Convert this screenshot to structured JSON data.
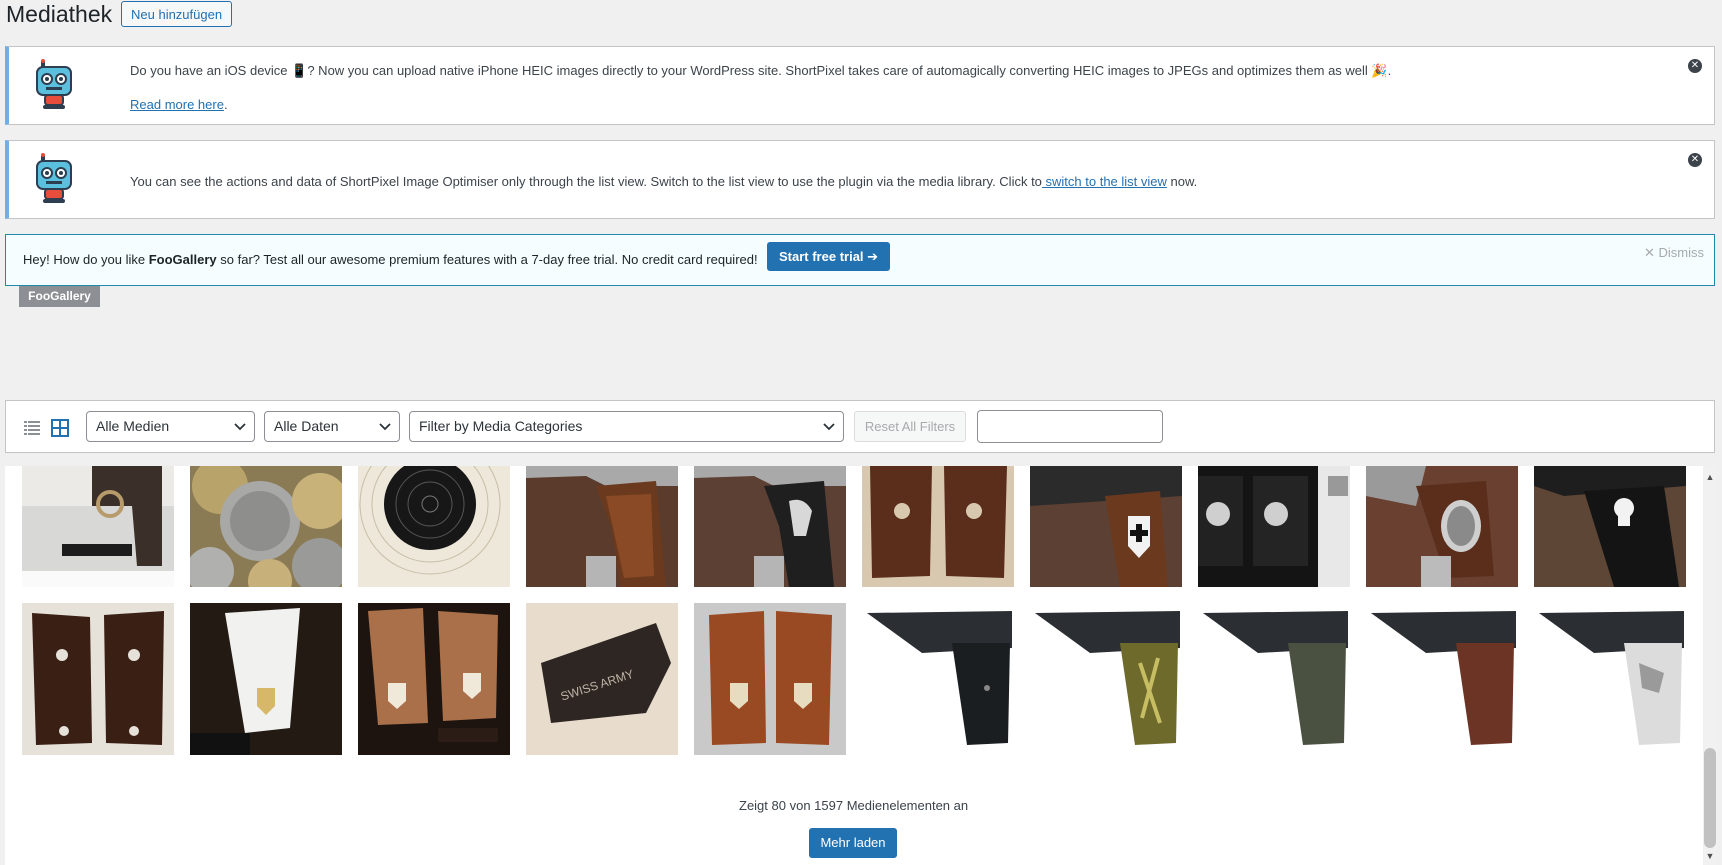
{
  "header": {
    "title": "Mediathek",
    "add_new_label": "Neu hinzufügen"
  },
  "notices": {
    "heic": {
      "text_before": "Do you have an iOS device 📱? Now you can upload native iPhone HEIC images directly to your WordPress site. ShortPixel takes care of automagically converting HEIC images to JPEGs and optimizes them as well 🎉.",
      "link": "Read more here",
      "link_suffix": "."
    },
    "listview": {
      "text_before": "You can see the actions and data of ShortPixel Image Optimiser only through the list view. Switch to the list view to use the plugin via the media library. Click to",
      "link": " switch to the list view",
      "text_after": " now."
    },
    "foogallery": {
      "text_prefix": "Hey! How do you like ",
      "brand": "FooGallery",
      "text_suffix": " so far? Test all our awesome premium features with a 7-day free trial. No credit card required!",
      "button": "Start free trial ➔",
      "dismiss": "Dismiss",
      "badge": "FooGallery"
    }
  },
  "toolbar": {
    "media_type": "Alle Medien",
    "dates": "Alle Daten",
    "categories": "Filter by Media Categories",
    "reset": "Reset All Filters",
    "search_value": ""
  },
  "grid": {
    "count_text": "Zeigt 80 von 1597 Medienelementen an",
    "load_more": "Mehr laden"
  },
  "colors": {
    "accent": "#2271b1",
    "notice_border": "#72aee6",
    "foo_border": "#1f8aa8"
  }
}
